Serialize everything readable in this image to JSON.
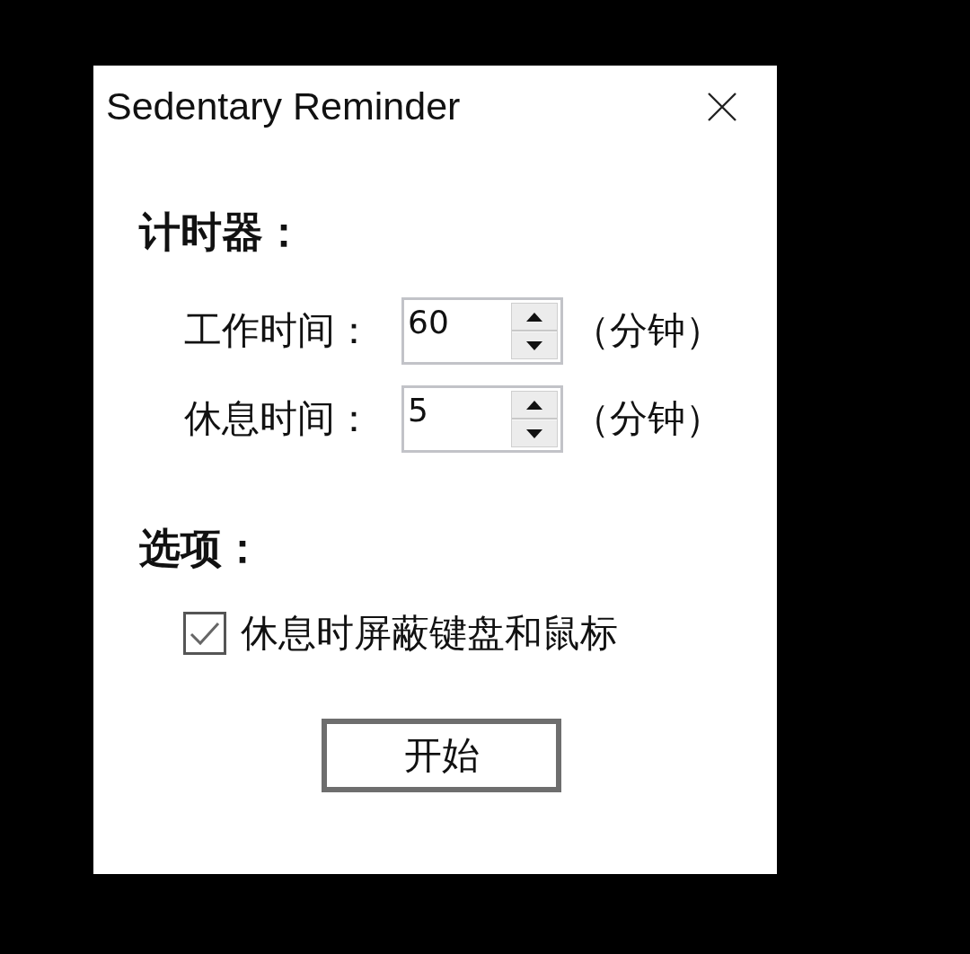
{
  "window": {
    "title": "Sedentary Reminder"
  },
  "timer": {
    "heading": "计时器：",
    "fields": [
      {
        "label": "工作时间：",
        "value": "60",
        "unit": "（分钟）"
      },
      {
        "label": "休息时间：",
        "value": "5",
        "unit": "（分钟）"
      }
    ]
  },
  "options": {
    "heading": "选项：",
    "checkboxes": [
      {
        "label": "休息时屏蔽键盘和鼠标",
        "checked": true
      }
    ]
  },
  "buttons": [
    "开始"
  ]
}
